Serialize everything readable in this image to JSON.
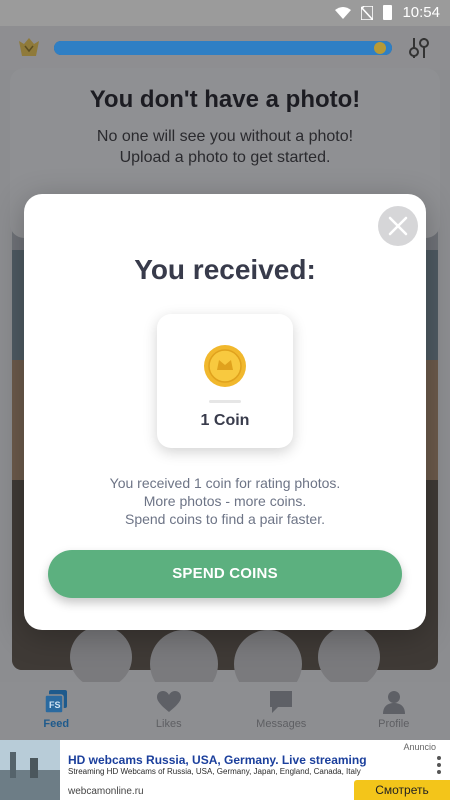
{
  "status_bar": {
    "time": "10:54"
  },
  "background": {
    "no_photo_title": "You don't have a photo!",
    "no_photo_line1": "No one will see you without a photo!",
    "no_photo_line2": "Upload a photo to get started."
  },
  "modal": {
    "title": "You received:",
    "reward_amount": "1 Coin",
    "desc_line1": "You received 1 coin for rating photos.",
    "desc_line2": "More photos - more coins.",
    "desc_line3": "Spend coins to find a pair faster.",
    "button_label": "SPEND COINS"
  },
  "bottom_nav": {
    "items": [
      {
        "label": "Feed",
        "icon": "feed-icon",
        "active": true
      },
      {
        "label": "Likes",
        "icon": "heart-icon",
        "active": false
      },
      {
        "label": "Messages",
        "icon": "chat-icon",
        "active": false
      },
      {
        "label": "Profile",
        "icon": "person-icon",
        "active": false
      }
    ]
  },
  "ad": {
    "badge": "Anuncio",
    "headline": "HD webcams Russia, USA, Germany. Live streaming",
    "description": "Streaming HD Webcams of Russia, USA, Germany, Japan, England, Canada, Italy",
    "domain": "webcamonline.ru",
    "cta": "Смотреть"
  },
  "colors": {
    "accent_green": "#5cb07f",
    "title_text": "#383b4b",
    "body_text": "#6d7486",
    "coin_gold": "#f1b82d"
  }
}
